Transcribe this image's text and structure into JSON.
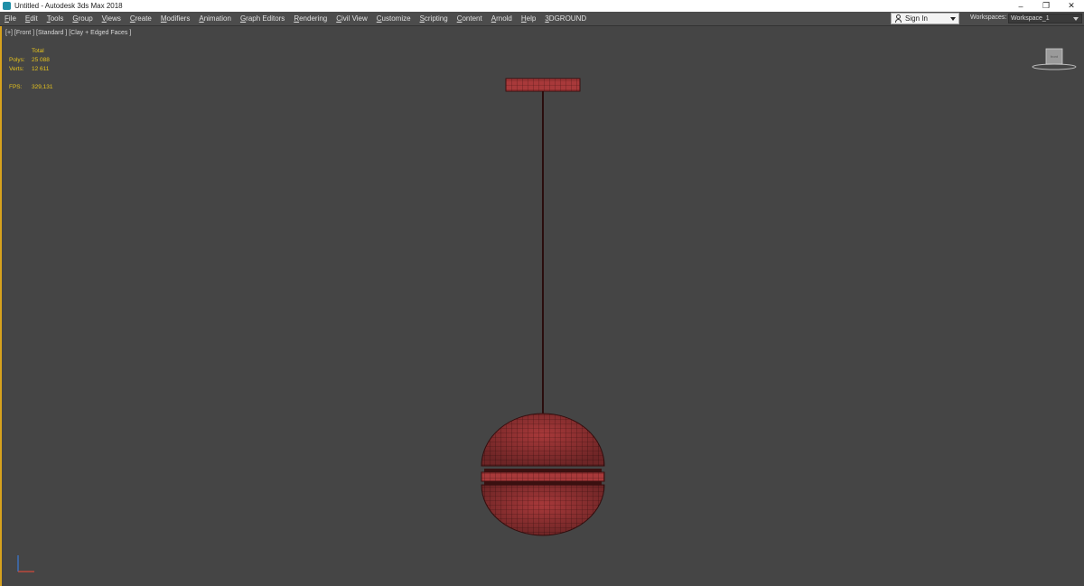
{
  "window": {
    "title": "Untitled - Autodesk 3ds Max 2018",
    "controls": {
      "minimize": "–",
      "restore": "❐",
      "close": "✕"
    }
  },
  "menu": {
    "items": [
      "File",
      "Edit",
      "Tools",
      "Group",
      "Views",
      "Create",
      "Modifiers",
      "Animation",
      "Graph Editors",
      "Rendering",
      "Civil View",
      "Customize",
      "Scripting",
      "Content",
      "Arnold",
      "Help",
      "3DGROUND"
    ],
    "sign_in": "Sign In",
    "workspaces_label": "Workspaces:",
    "workspace_value": "Workspace_1"
  },
  "viewport": {
    "label": "[+] [Front ] [Standard ] [Clay + Edged Faces ]",
    "stats": {
      "header": "Total",
      "polys_label": "Polys:",
      "polys_value": "25 088",
      "verts_label": "Verts:",
      "verts_value": "12 611",
      "fps_label": "FPS:",
      "fps_value": "329,131"
    },
    "navcube_label": "front"
  },
  "colors": {
    "accent_border": "#d7a21d",
    "stats_text": "#e6c31e",
    "model_fill": "#a8393a",
    "model_edges": "#4a1414",
    "viewport_bg": "#454545"
  }
}
